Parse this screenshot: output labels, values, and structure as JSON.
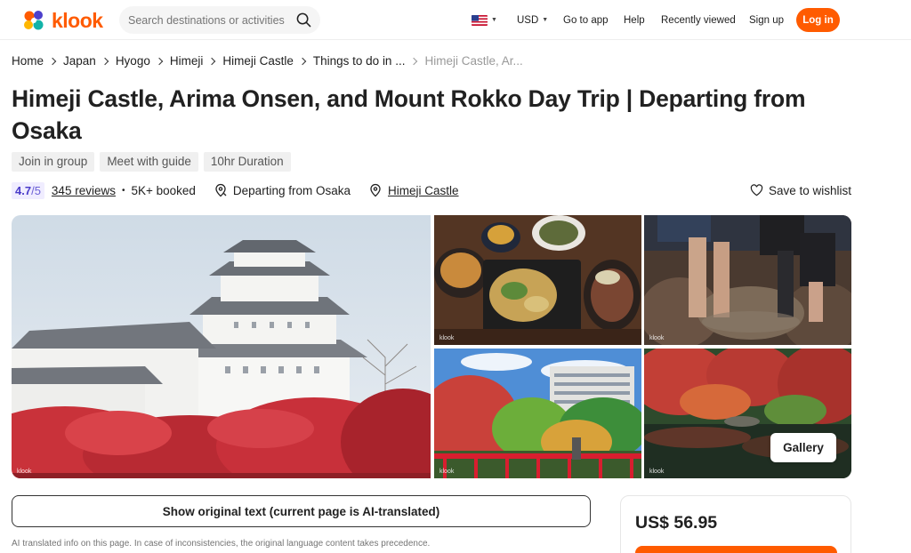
{
  "header": {
    "logo_text": "klook",
    "search_placeholder": "Search destinations or activities",
    "currency": "USD",
    "nav": [
      "Go to app",
      "Help",
      "Recently viewed",
      "Sign up"
    ],
    "login": "Log in",
    "brand_color": "#ff5b00"
  },
  "breadcrumb": {
    "items": [
      "Home",
      "Japan",
      "Hyogo",
      "Himeji",
      "Himeji Castle",
      "Things to do in ..."
    ],
    "current": "Himeji Castle, Ar..."
  },
  "title_line1": "Himeji Castle, Arima Onsen, and Mount Rokko Day Trip | Departing from",
  "title_line2": "Osaka",
  "tags": [
    "Join in group",
    "Meet with guide",
    "10hr Duration"
  ],
  "meta": {
    "rating": "4.7",
    "rating_den": "/5",
    "reviews": "345 reviews",
    "booked": "5K+ booked",
    "departing": "Departing from Osaka",
    "location": "Himeji Castle",
    "wishlist": "Save to wishlist"
  },
  "gallery": {
    "watermark": "klook",
    "button": "Gallery"
  },
  "translate": {
    "button": "Show original text (current page is AI-translated)",
    "note": "AI translated info on this page. In case of inconsistencies, the original language content takes precedence."
  },
  "price": "US$ 56.95"
}
